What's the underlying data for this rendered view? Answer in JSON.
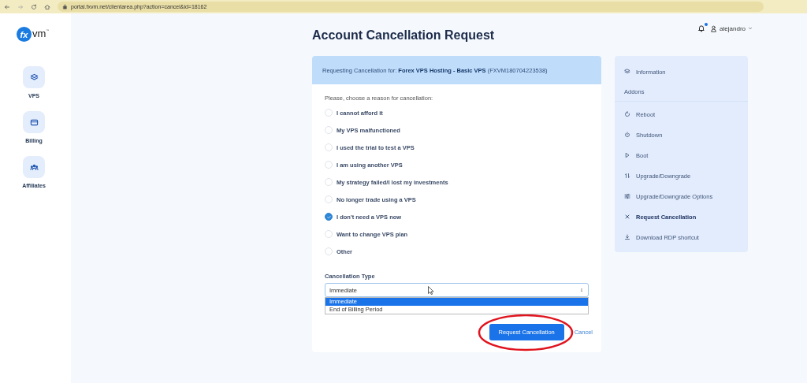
{
  "browser": {
    "url": "portal.fxvm.net/clientarea.php?action=cancel&id=18162"
  },
  "logo": {
    "mark": "fx",
    "name": "vm",
    "trademark": "™"
  },
  "sidebar": {
    "items": [
      {
        "label": "VPS"
      },
      {
        "label": "Billing"
      },
      {
        "label": "Affiliates"
      }
    ]
  },
  "header": {
    "user": "alejandro",
    "notification_dot": true
  },
  "title": "Account Cancellation Request",
  "request": {
    "prefix": "Requesting Cancellation for:",
    "product": "Forex VPS Hosting - Basic VPS",
    "id": "(FXVM180704223538)"
  },
  "reason_prompt": "Please, choose a reason for cancellation:",
  "reasons": [
    {
      "label": "I cannot afford it",
      "selected": false
    },
    {
      "label": "My VPS malfunctioned",
      "selected": false
    },
    {
      "label": "I used the trial to test a VPS",
      "selected": false
    },
    {
      "label": "I am using another VPS",
      "selected": false
    },
    {
      "label": "My strategy failed/I lost my investments",
      "selected": false
    },
    {
      "label": "No longer trade using a VPS",
      "selected": false
    },
    {
      "label": "I don't need a VPS now",
      "selected": true
    },
    {
      "label": "Want to change VPS plan",
      "selected": false
    },
    {
      "label": "Other",
      "selected": false
    }
  ],
  "cancellation_type": {
    "label": "Cancellation Type",
    "value": "Immediate",
    "expanded": true,
    "options": [
      {
        "label": "Immediate",
        "selected": true
      },
      {
        "label": "End of Billing Period",
        "selected": false
      }
    ]
  },
  "buttons": {
    "submit": "Request Cancellation",
    "cancel": "Cancel"
  },
  "menu": [
    {
      "kind": "item",
      "label": "Information",
      "selected": false
    },
    {
      "kind": "heading",
      "label": "Addons"
    },
    {
      "kind": "item",
      "label": "Reboot",
      "selected": false
    },
    {
      "kind": "item",
      "label": "Shutdown",
      "selected": false
    },
    {
      "kind": "item",
      "label": "Boot",
      "selected": false
    },
    {
      "kind": "item",
      "label": "Upgrade/Downgrade",
      "selected": false
    },
    {
      "kind": "item",
      "label": "Upgrade/Downgrade Options",
      "selected": false
    },
    {
      "kind": "item",
      "label": "Request Cancellation",
      "selected": true
    },
    {
      "kind": "item",
      "label": "Download RDP shortcut",
      "selected": false
    }
  ]
}
